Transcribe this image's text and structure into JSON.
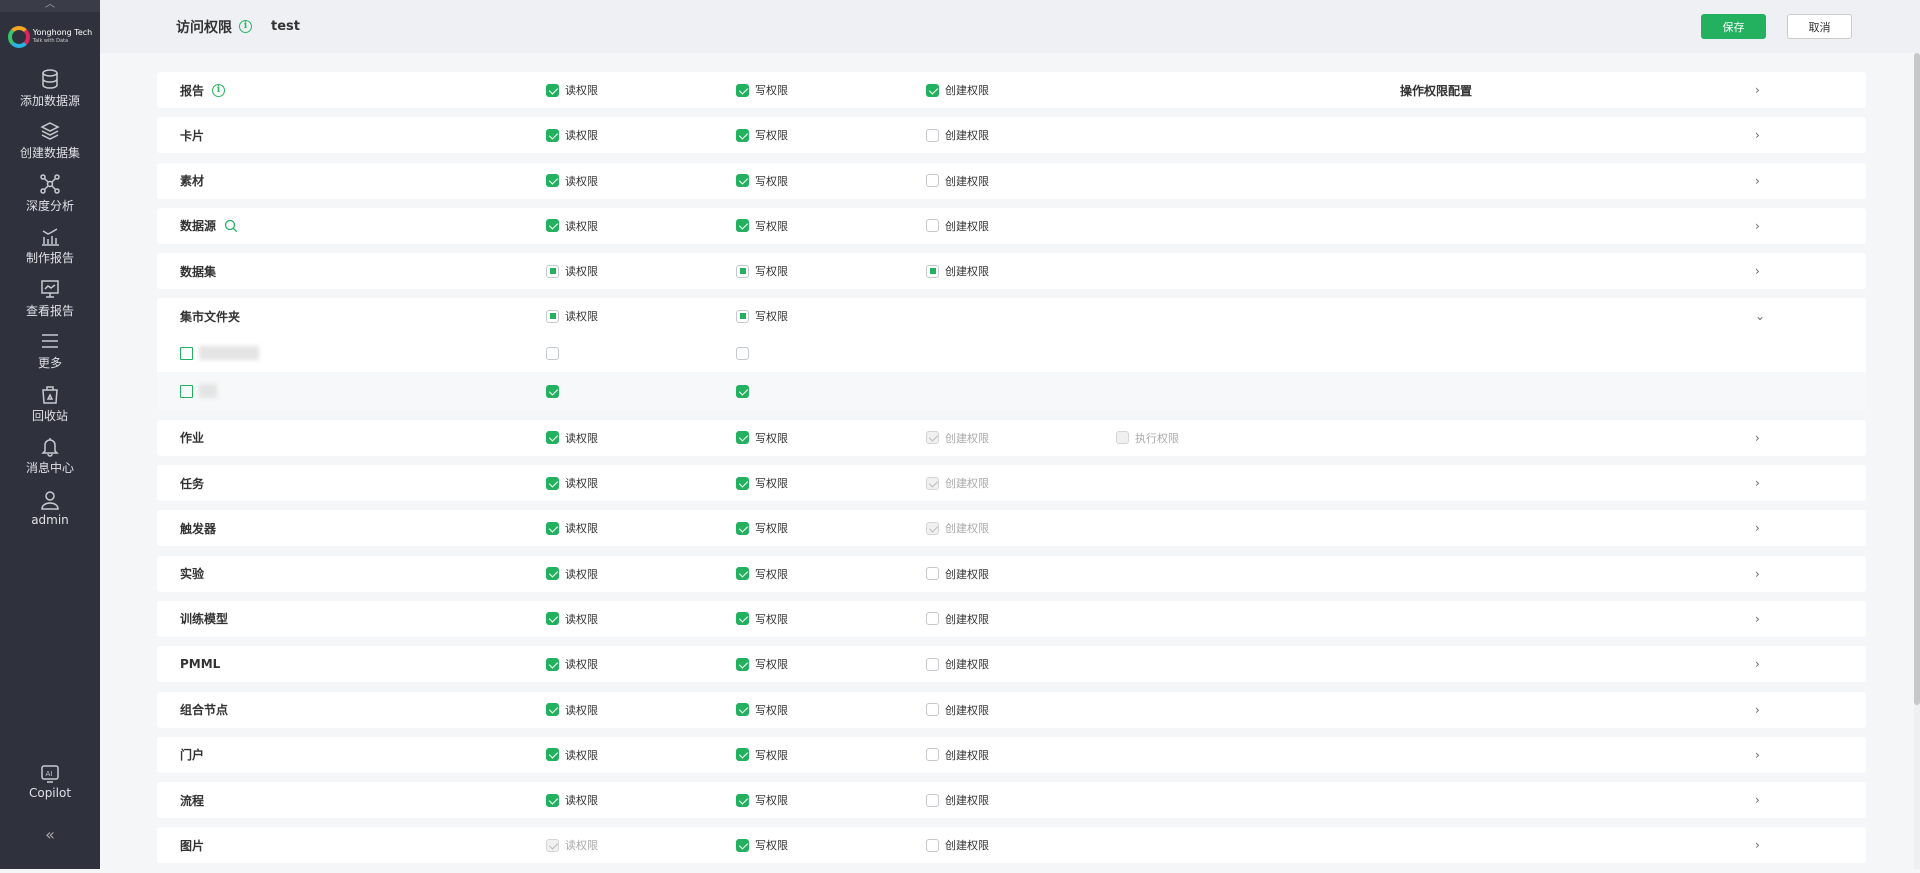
{
  "sidebar": {
    "logo": {
      "name": "Yonghong Tech",
      "tagline": "Talk with Data"
    },
    "items": [
      {
        "label": "添加数据源",
        "icon": "database-icon"
      },
      {
        "label": "创建数据集",
        "icon": "layers-icon"
      },
      {
        "label": "深度分析",
        "icon": "network-icon"
      },
      {
        "label": "制作报告",
        "icon": "bar-chart-icon"
      },
      {
        "label": "查看报告",
        "icon": "monitor-icon"
      },
      {
        "label": "更多",
        "icon": "menu-icon"
      },
      {
        "label": "回收站",
        "icon": "trash-icon"
      },
      {
        "label": "消息中心",
        "icon": "bell-icon"
      },
      {
        "label": "admin",
        "icon": "user-icon"
      }
    ],
    "copilot": "Copilot",
    "collapse": "«"
  },
  "header": {
    "title": "访问权限",
    "role": "test",
    "save": "保存",
    "cancel": "取消"
  },
  "rows": [
    {
      "label": "报告",
      "info": true,
      "cells": [
        [
          "读权限",
          "checked"
        ],
        [
          "写权限",
          "checked"
        ],
        [
          "创建权限",
          "checked"
        ]
      ],
      "op": "操作权限配置"
    },
    {
      "label": "卡片",
      "cells": [
        [
          "读权限",
          "checked"
        ],
        [
          "写权限",
          "checked"
        ],
        [
          "创建权限",
          "unchecked"
        ]
      ]
    },
    {
      "label": "素材",
      "cells": [
        [
          "读权限",
          "checked"
        ],
        [
          "写权限",
          "checked"
        ],
        [
          "创建权限",
          "unchecked"
        ]
      ]
    },
    {
      "label": "数据源",
      "search": true,
      "cells": [
        [
          "读权限",
          "checked"
        ],
        [
          "写权限",
          "checked"
        ],
        [
          "创建权限",
          "unchecked"
        ]
      ]
    },
    {
      "label": "数据集",
      "cells": [
        [
          "读权限",
          "partial"
        ],
        [
          "写权限",
          "partial"
        ],
        [
          "创建权限",
          "partial"
        ]
      ]
    },
    {
      "label": "集市文件夹",
      "expanded": true,
      "cells": [
        [
          "读权限",
          "partial"
        ],
        [
          "写权限",
          "partial"
        ]
      ],
      "children": [
        {
          "cells": [
            "unchecked",
            "unchecked"
          ]
        },
        {
          "cells": [
            "checked",
            "checked"
          ]
        }
      ]
    },
    {
      "label": "作业",
      "cells": [
        [
          "读权限",
          "checked"
        ],
        [
          "写权限",
          "checked"
        ],
        [
          "创建权限",
          "disabled-checked"
        ],
        [
          "执行权限",
          "disabled-unchecked"
        ]
      ]
    },
    {
      "label": "任务",
      "cells": [
        [
          "读权限",
          "checked"
        ],
        [
          "写权限",
          "checked"
        ],
        [
          "创建权限",
          "disabled-checked"
        ]
      ]
    },
    {
      "label": "触发器",
      "cells": [
        [
          "读权限",
          "checked"
        ],
        [
          "写权限",
          "checked"
        ],
        [
          "创建权限",
          "disabled-checked"
        ]
      ]
    },
    {
      "label": "实验",
      "cells": [
        [
          "读权限",
          "checked"
        ],
        [
          "写权限",
          "checked"
        ],
        [
          "创建权限",
          "unchecked"
        ]
      ]
    },
    {
      "label": "训练模型",
      "cells": [
        [
          "读权限",
          "checked"
        ],
        [
          "写权限",
          "checked"
        ],
        [
          "创建权限",
          "unchecked"
        ]
      ]
    },
    {
      "label": "PMML",
      "cells": [
        [
          "读权限",
          "checked"
        ],
        [
          "写权限",
          "checked"
        ],
        [
          "创建权限",
          "unchecked"
        ]
      ]
    },
    {
      "label": "组合节点",
      "cells": [
        [
          "读权限",
          "checked"
        ],
        [
          "写权限",
          "checked"
        ],
        [
          "创建权限",
          "unchecked"
        ]
      ]
    },
    {
      "label": "门户",
      "cells": [
        [
          "读权限",
          "checked"
        ],
        [
          "写权限",
          "checked"
        ],
        [
          "创建权限",
          "unchecked"
        ]
      ]
    },
    {
      "label": "流程",
      "cells": [
        [
          "读权限",
          "checked"
        ],
        [
          "写权限",
          "checked"
        ],
        [
          "创建权限",
          "unchecked"
        ]
      ]
    },
    {
      "label": "图片",
      "cells": [
        [
          "读权限",
          "disabled-checked"
        ],
        [
          "写权限",
          "checked"
        ],
        [
          "创建权限",
          "unchecked"
        ]
      ]
    }
  ],
  "colors": {
    "accent": "#23b15f",
    "sidebar": "#2f323d"
  }
}
